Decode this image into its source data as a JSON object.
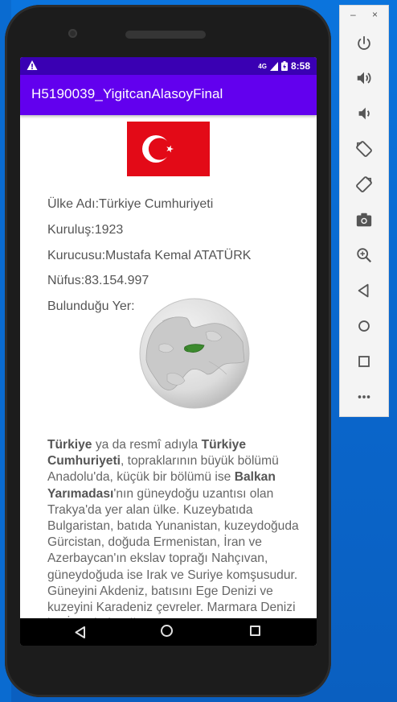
{
  "device": {
    "status_bar": {
      "network": "4G",
      "time": "8:58"
    },
    "app_bar": {
      "title": "H5190039_YigitcanAlasoyFinal"
    },
    "country": {
      "name_line": "Ülke Adı:Türkiye Cumhuriyeti",
      "founded_line": "Kuruluş:1923",
      "founder_line": "Kurucusu:Mustafa Kemal ATATÜRK",
      "population_line": "Nüfus:83.154.997",
      "location_label": "Bulunduğu Yer:"
    },
    "article": {
      "b1": "Türkiye",
      "t1": " ya da resmî adıyla ",
      "b2": "Türkiye Cumhuriyeti",
      "t2": ", topraklarının büyük bölümü Anadolu'da, küçük bir bölümü ise ",
      "b3": "Balkan Yarımadası",
      "t3": "'nın güneydoğu uzantısı olan Trakya'da yer alan ülke. Kuzeybatıda Bulgaristan, batıda Yunanistan, kuzeydoğuda Gürcistan, doğuda Ermenistan, İran ve Azerbaycan'ın ekslav toprağı Nahçıvan, güneydoğuda ise Irak ve Suriye komşusudur. Güneyini Akdeniz, batısını Ege Denizi ve kuzeyini Karadeniz çevreler. Marmara Denizi ise İstanbul Boğazı"
    }
  },
  "emulator_panel": {
    "minimize": "–",
    "close": "×",
    "buttons": [
      "power-icon",
      "volume-up-icon",
      "volume-down-icon",
      "rotate-left-icon",
      "rotate-right-icon",
      "camera-icon",
      "zoom-icon",
      "back-icon",
      "home-icon",
      "overview-icon",
      "more-icon"
    ]
  },
  "colors": {
    "status_bar": "#3a00b3",
    "app_bar": "#6200ee",
    "flag_red": "#e30a17"
  }
}
